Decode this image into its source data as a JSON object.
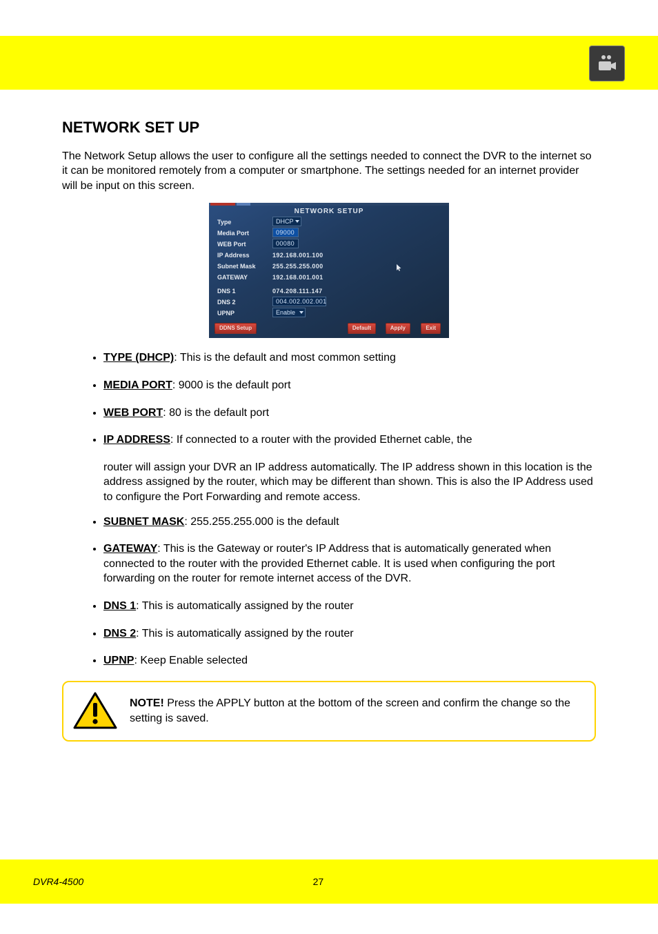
{
  "header": {
    "icon": "camera-icon"
  },
  "section": {
    "heading": "NETWORK SET UP",
    "intro": "The Network Setup allows the user to configure all the settings needed to connect the DVR to the internet so it can be monitored remotely from a computer or smartphone. The settings needed for an internet provider will be input on this screen."
  },
  "screenshot": {
    "title": "NETWORK  SETUP",
    "rows": {
      "type_label": "Type",
      "type_value": "DHCP",
      "media_label": "Media  Port",
      "media_value": "09000",
      "web_label": "WEB  Port",
      "web_value": "00080",
      "ip_label": "IP  Address",
      "ip_value": "192.168.001.100",
      "subnet_label": "Subnet  Mask",
      "subnet_value": "255.255.255.000",
      "gateway_label": "GATEWAY",
      "gateway_value": "192.168.001.001",
      "dns1_label": "DNS  1",
      "dns1_value": "074.208.111.147",
      "dns2_label": "DNS  2",
      "dns2_value": "004.002.002.001",
      "upnp_label": "UPNP",
      "upnp_value": "Enable",
      "ddns_label": "DDNS   Setup"
    },
    "buttons": {
      "default": "Default",
      "apply": "Apply",
      "exit": "Exit"
    }
  },
  "bullets1": [
    {
      "term": "TYPE (DHCP)",
      "rest": ": This is the default and most common setting"
    },
    {
      "term": "MEDIA PORT",
      "rest": ": 9000 is the default port"
    },
    {
      "term": "WEB PORT",
      "rest": ": 80 is the default port"
    },
    {
      "term": "IP ADDRESS",
      "rest": ": If connected to a router with the provided Ethernet cable, the"
    }
  ],
  "ip_runon": "router will assign your DVR an IP address automatically. The IP address shown in this location is the address assigned by the router, which may be different than shown. This is also the IP Address used to configure the Port Forwarding and remote access.",
  "bullets2": [
    {
      "term": "SUBNET MASK",
      "rest": ": 255.255.255.000 is the default"
    },
    {
      "term": "GATEWAY",
      "rest": ": This is the Gateway or router's IP Address that is automatically generated when connected to the router with the provided Ethernet cable. It is used when configuring the port forwarding on the router for remote internet access of the DVR."
    },
    {
      "term": "DNS 1",
      "rest": ": This is automatically assigned by the router"
    },
    {
      "term": "DNS 2",
      "rest": ": This is automatically assigned by the router"
    },
    {
      "term": "UPNP",
      "rest": ": Keep Enable selected"
    }
  ],
  "note": {
    "label": "NOTE!",
    "text": " Press the APPLY button at the bottom of the screen and confirm the change so the setting is saved."
  },
  "footer": {
    "brand": "DVR4-4500    ",
    "page": "27",
    "right": ""
  }
}
